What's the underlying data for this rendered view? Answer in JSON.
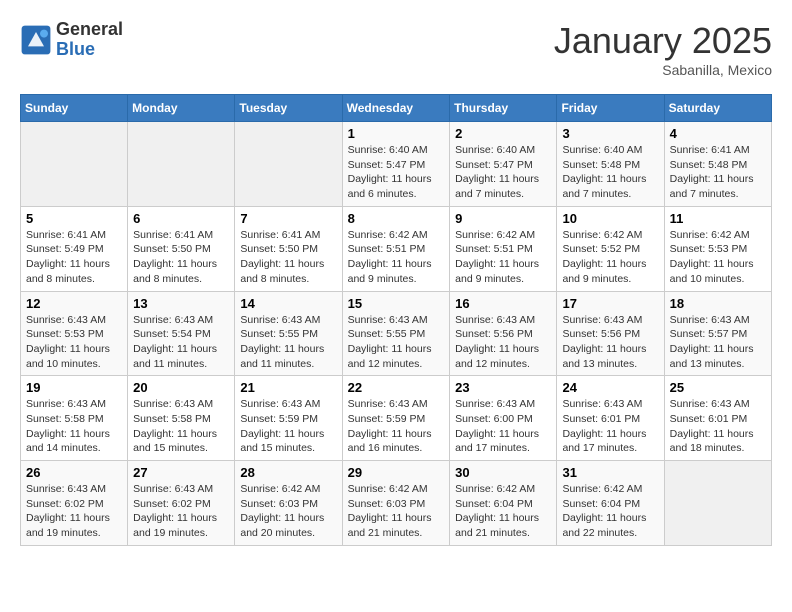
{
  "header": {
    "logo_general": "General",
    "logo_blue": "Blue",
    "month_title": "January 2025",
    "subtitle": "Sabanilla, Mexico"
  },
  "weekdays": [
    "Sunday",
    "Monday",
    "Tuesday",
    "Wednesday",
    "Thursday",
    "Friday",
    "Saturday"
  ],
  "weeks": [
    [
      {
        "day": "",
        "info": ""
      },
      {
        "day": "",
        "info": ""
      },
      {
        "day": "",
        "info": ""
      },
      {
        "day": "1",
        "info": "Sunrise: 6:40 AM\nSunset: 5:47 PM\nDaylight: 11 hours and 6 minutes."
      },
      {
        "day": "2",
        "info": "Sunrise: 6:40 AM\nSunset: 5:47 PM\nDaylight: 11 hours and 7 minutes."
      },
      {
        "day": "3",
        "info": "Sunrise: 6:40 AM\nSunset: 5:48 PM\nDaylight: 11 hours and 7 minutes."
      },
      {
        "day": "4",
        "info": "Sunrise: 6:41 AM\nSunset: 5:48 PM\nDaylight: 11 hours and 7 minutes."
      }
    ],
    [
      {
        "day": "5",
        "info": "Sunrise: 6:41 AM\nSunset: 5:49 PM\nDaylight: 11 hours and 8 minutes."
      },
      {
        "day": "6",
        "info": "Sunrise: 6:41 AM\nSunset: 5:50 PM\nDaylight: 11 hours and 8 minutes."
      },
      {
        "day": "7",
        "info": "Sunrise: 6:41 AM\nSunset: 5:50 PM\nDaylight: 11 hours and 8 minutes."
      },
      {
        "day": "8",
        "info": "Sunrise: 6:42 AM\nSunset: 5:51 PM\nDaylight: 11 hours and 9 minutes."
      },
      {
        "day": "9",
        "info": "Sunrise: 6:42 AM\nSunset: 5:51 PM\nDaylight: 11 hours and 9 minutes."
      },
      {
        "day": "10",
        "info": "Sunrise: 6:42 AM\nSunset: 5:52 PM\nDaylight: 11 hours and 9 minutes."
      },
      {
        "day": "11",
        "info": "Sunrise: 6:42 AM\nSunset: 5:53 PM\nDaylight: 11 hours and 10 minutes."
      }
    ],
    [
      {
        "day": "12",
        "info": "Sunrise: 6:43 AM\nSunset: 5:53 PM\nDaylight: 11 hours and 10 minutes."
      },
      {
        "day": "13",
        "info": "Sunrise: 6:43 AM\nSunset: 5:54 PM\nDaylight: 11 hours and 11 minutes."
      },
      {
        "day": "14",
        "info": "Sunrise: 6:43 AM\nSunset: 5:55 PM\nDaylight: 11 hours and 11 minutes."
      },
      {
        "day": "15",
        "info": "Sunrise: 6:43 AM\nSunset: 5:55 PM\nDaylight: 11 hours and 12 minutes."
      },
      {
        "day": "16",
        "info": "Sunrise: 6:43 AM\nSunset: 5:56 PM\nDaylight: 11 hours and 12 minutes."
      },
      {
        "day": "17",
        "info": "Sunrise: 6:43 AM\nSunset: 5:56 PM\nDaylight: 11 hours and 13 minutes."
      },
      {
        "day": "18",
        "info": "Sunrise: 6:43 AM\nSunset: 5:57 PM\nDaylight: 11 hours and 13 minutes."
      }
    ],
    [
      {
        "day": "19",
        "info": "Sunrise: 6:43 AM\nSunset: 5:58 PM\nDaylight: 11 hours and 14 minutes."
      },
      {
        "day": "20",
        "info": "Sunrise: 6:43 AM\nSunset: 5:58 PM\nDaylight: 11 hours and 15 minutes."
      },
      {
        "day": "21",
        "info": "Sunrise: 6:43 AM\nSunset: 5:59 PM\nDaylight: 11 hours and 15 minutes."
      },
      {
        "day": "22",
        "info": "Sunrise: 6:43 AM\nSunset: 5:59 PM\nDaylight: 11 hours and 16 minutes."
      },
      {
        "day": "23",
        "info": "Sunrise: 6:43 AM\nSunset: 6:00 PM\nDaylight: 11 hours and 17 minutes."
      },
      {
        "day": "24",
        "info": "Sunrise: 6:43 AM\nSunset: 6:01 PM\nDaylight: 11 hours and 17 minutes."
      },
      {
        "day": "25",
        "info": "Sunrise: 6:43 AM\nSunset: 6:01 PM\nDaylight: 11 hours and 18 minutes."
      }
    ],
    [
      {
        "day": "26",
        "info": "Sunrise: 6:43 AM\nSunset: 6:02 PM\nDaylight: 11 hours and 19 minutes."
      },
      {
        "day": "27",
        "info": "Sunrise: 6:43 AM\nSunset: 6:02 PM\nDaylight: 11 hours and 19 minutes."
      },
      {
        "day": "28",
        "info": "Sunrise: 6:42 AM\nSunset: 6:03 PM\nDaylight: 11 hours and 20 minutes."
      },
      {
        "day": "29",
        "info": "Sunrise: 6:42 AM\nSunset: 6:03 PM\nDaylight: 11 hours and 21 minutes."
      },
      {
        "day": "30",
        "info": "Sunrise: 6:42 AM\nSunset: 6:04 PM\nDaylight: 11 hours and 21 minutes."
      },
      {
        "day": "31",
        "info": "Sunrise: 6:42 AM\nSunset: 6:04 PM\nDaylight: 11 hours and 22 minutes."
      },
      {
        "day": "",
        "info": ""
      }
    ]
  ]
}
